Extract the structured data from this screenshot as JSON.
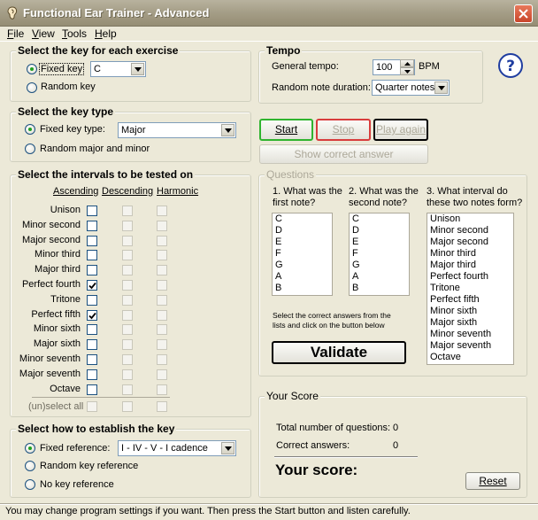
{
  "window": {
    "title": "Functional Ear Trainer - Advanced"
  },
  "menu": [
    {
      "first": "F",
      "rest": "ile"
    },
    {
      "first": "V",
      "rest": "iew"
    },
    {
      "first": "T",
      "rest": "ools"
    },
    {
      "first": "H",
      "rest": "elp"
    }
  ],
  "key_section": {
    "title": "Select the key for each exercise",
    "fixed_label": "Fixed key",
    "fixed_value": "C",
    "random_label": "Random key"
  },
  "key_type_section": {
    "title": "Select the key type",
    "fixed_label": "Fixed key type:",
    "fixed_value": "Major",
    "random_label": "Random major and minor"
  },
  "intervals_section": {
    "title": "Select the intervals to be tested on",
    "col_ascending": "Ascending",
    "col_descending": "Descending",
    "col_harmonic": "Harmonic",
    "rows": [
      {
        "label": "Unison",
        "asc": false
      },
      {
        "label": "Minor second",
        "asc": false
      },
      {
        "label": "Major second",
        "asc": false
      },
      {
        "label": "Minor third",
        "asc": false
      },
      {
        "label": "Major third",
        "asc": false
      },
      {
        "label": "Perfect fourth",
        "asc": true
      },
      {
        "label": "Tritone",
        "asc": false
      },
      {
        "label": "Perfect fifth",
        "asc": true
      },
      {
        "label": "Minor sixth",
        "asc": false
      },
      {
        "label": "Major sixth",
        "asc": false
      },
      {
        "label": "Minor seventh",
        "asc": false
      },
      {
        "label": "Major seventh",
        "asc": false
      },
      {
        "label": "Octave",
        "asc": false
      }
    ],
    "unselect_label": "(un)select all"
  },
  "reference_section": {
    "title": "Select how to establish the key",
    "fixed_label": "Fixed reference:",
    "fixed_value": "I - IV - V - I  cadence",
    "random_label": "Random key reference",
    "none_label": "No key reference"
  },
  "tempo_section": {
    "title": "Tempo",
    "general_label": "General tempo:",
    "general_value": "100",
    "bpm_label": "BPM",
    "duration_label": "Random note duration:",
    "duration_value": "Quarter notes"
  },
  "buttons": {
    "start": "Start",
    "stop": "Stop",
    "play_again": "Play again",
    "show_answer": "Show correct answer",
    "validate": "Validate",
    "reset": "Reset"
  },
  "questions_section": {
    "title": "Questions",
    "q1": "1. What was the first note?",
    "q2": "2. What was the second note?",
    "q3": "3. What interval do these two notes form?",
    "notes": [
      "C",
      "D",
      "E",
      "F",
      "G",
      "A",
      "B"
    ],
    "intervals": [
      "Unison",
      "Minor second",
      "Major second",
      "Minor third",
      "Major third",
      "Perfect fourth",
      "Tritone",
      "Perfect fifth",
      "Minor sixth",
      "Major sixth",
      "Minor seventh",
      "Major seventh",
      "Octave"
    ],
    "instructions": "Select the correct answers from the lists and click on the button below"
  },
  "score_section": {
    "title": "Your Score",
    "total_label": "Total number of questions:",
    "total_value": "0",
    "correct_label": "Correct answers:",
    "correct_value": "0",
    "score_label": "Your score:"
  },
  "status": {
    "text": "You may change program settings if you want. Then press the Start button and listen carefully."
  }
}
